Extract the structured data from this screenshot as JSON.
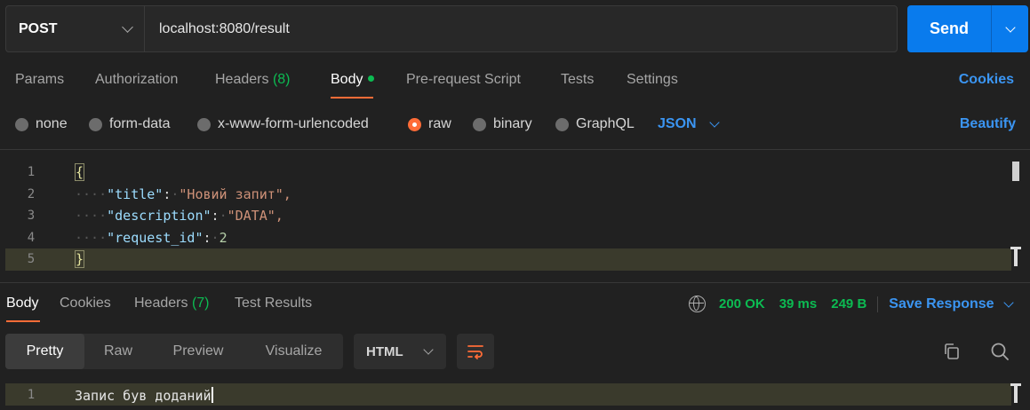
{
  "request": {
    "method": "POST",
    "url": "localhost:8080/result",
    "send_label": "Send"
  },
  "request_tabs": {
    "params": "Params",
    "authorization": "Authorization",
    "headers": "Headers",
    "headers_count": "(8)",
    "body": "Body",
    "prerequest": "Pre-request Script",
    "tests": "Tests",
    "settings": "Settings",
    "cookies": "Cookies"
  },
  "body_types": {
    "none": "none",
    "form_data": "form-data",
    "urlencoded": "x-www-form-urlencoded",
    "raw": "raw",
    "binary": "binary",
    "graphql": "GraphQL",
    "selected": "raw",
    "language": "JSON",
    "beautify": "Beautify"
  },
  "request_body": {
    "line_numbers": [
      "1",
      "2",
      "3",
      "4",
      "5"
    ],
    "open_brace": "{",
    "close_brace": "}",
    "fields": [
      {
        "key": "\"title\"",
        "value": "\"Новий запит\","
      },
      {
        "key": "\"description\"",
        "value": "\"DATA\","
      },
      {
        "key": "\"request_id\"",
        "value": "2"
      }
    ]
  },
  "response_tabs": {
    "body": "Body",
    "cookies": "Cookies",
    "headers": "Headers",
    "headers_count": "(7)",
    "test_results": "Test Results"
  },
  "response_meta": {
    "status": "200 OK",
    "time": "39 ms",
    "size": "249 B",
    "save_response": "Save Response"
  },
  "response_view": {
    "modes": [
      "Pretty",
      "Raw",
      "Preview",
      "Visualize"
    ],
    "active_mode": "Pretty",
    "format": "HTML"
  },
  "response_body": {
    "line_number": "1",
    "text": "Запис був доданий"
  },
  "colors": {
    "accent_orange": "#ff6c37",
    "link_blue": "#3b95f2",
    "send_blue": "#097bed",
    "success_green": "#0cbb52"
  }
}
